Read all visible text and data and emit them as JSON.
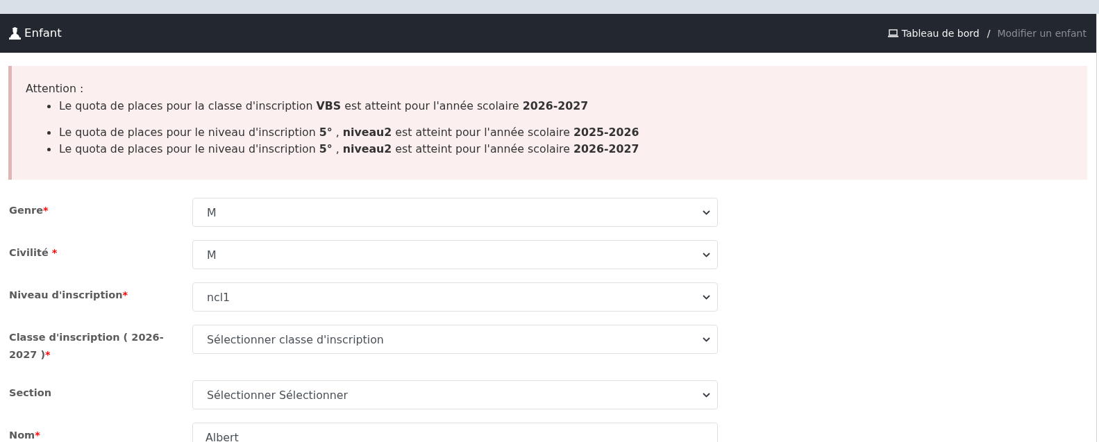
{
  "header": {
    "title": "Enfant",
    "breadcrumb": {
      "items": [
        {
          "label": "Tableau de bord",
          "kind": "link"
        },
        {
          "label": "Modifier un enfant",
          "kind": "current"
        }
      ],
      "separator": "/"
    }
  },
  "alert": {
    "title": "Attention :",
    "groups": [
      [
        "Le quota de places pour la classe d'inscription **VBS** est atteint pour l'année scolaire **2026-2027**"
      ],
      [
        "Le quota de places pour le niveau d'inscription **5°** , **niveau2** est atteint pour l'année scolaire **2025-2026**",
        "Le quota de places pour le niveau d'inscription **5°** , **niveau2** est atteint pour l'année scolaire **2026-2027**"
      ]
    ]
  },
  "form": {
    "fields": [
      {
        "label": "Genre",
        "required_mark": "*",
        "mark_spaced": false,
        "kind": "select",
        "value": "M"
      },
      {
        "label": "Civilité",
        "required_mark": "*",
        "mark_spaced": true,
        "kind": "select",
        "value": "M"
      },
      {
        "label": "Niveau d'inscription",
        "required_mark": "*",
        "mark_spaced": false,
        "kind": "select",
        "value": "ncl1"
      },
      {
        "label": "Classe d'inscription ( 2026-2027 )",
        "required_mark": "*",
        "mark_spaced": false,
        "kind": "select",
        "value": "Sélectionner classe d'inscription"
      },
      {
        "label": "Section",
        "kind": "select",
        "value": "Sélectionner Sélectionner"
      },
      {
        "label": "Nom",
        "required_mark": "*",
        "mark_spaced": false,
        "kind": "text",
        "value": "Albert"
      }
    ]
  }
}
